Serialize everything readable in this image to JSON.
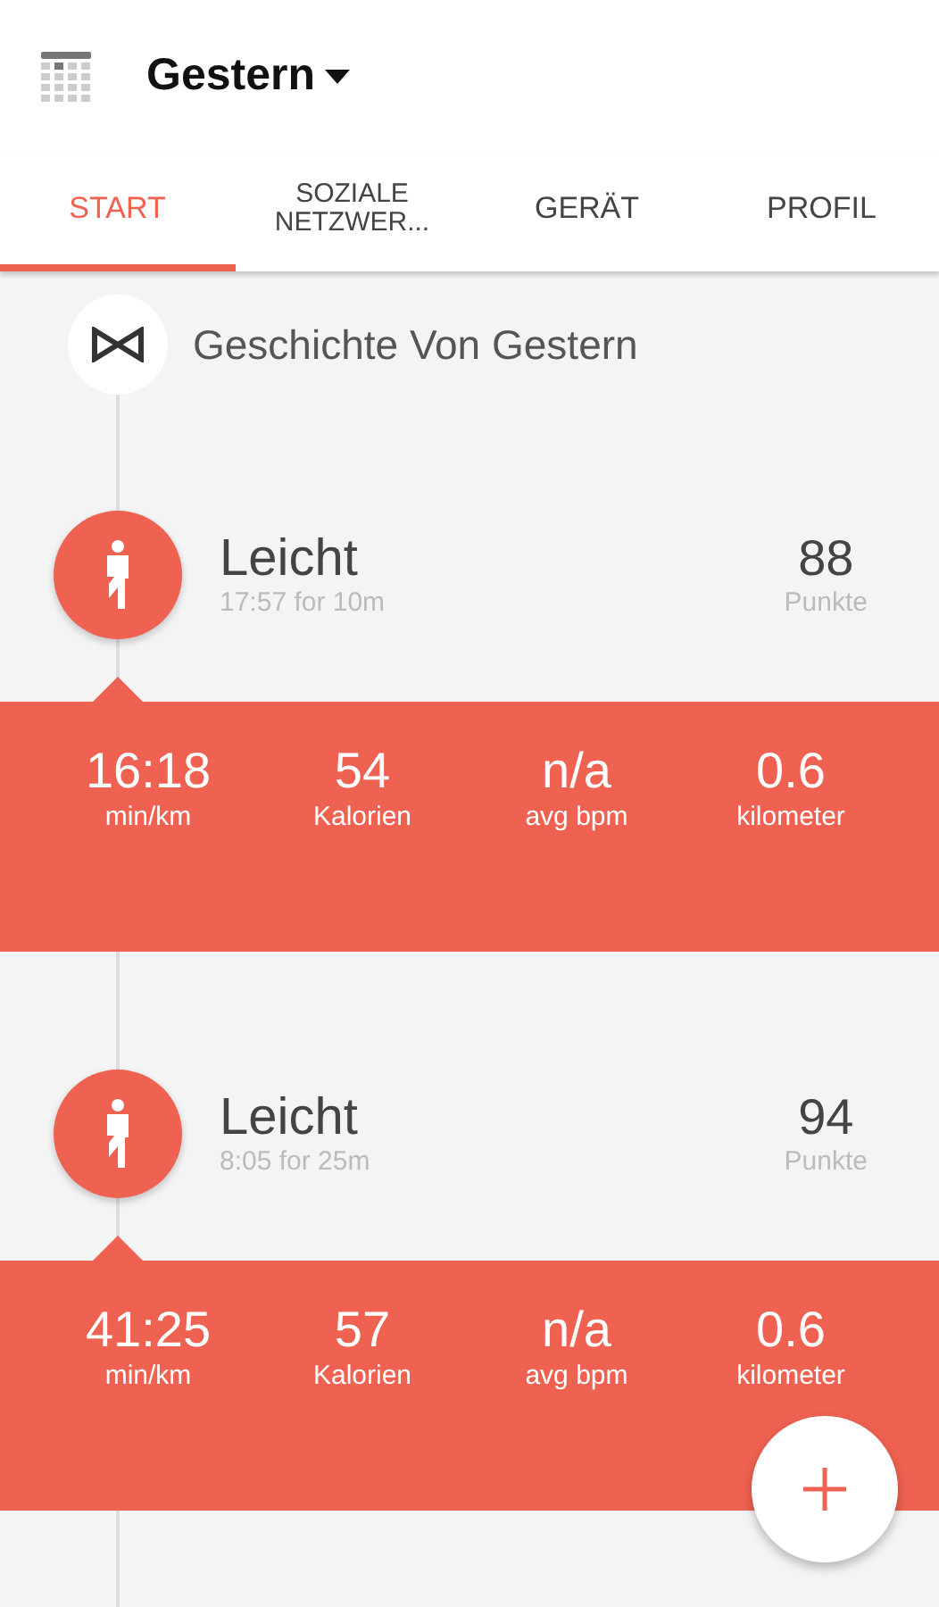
{
  "header": {
    "title": "Gestern"
  },
  "tabs": [
    {
      "label": "START",
      "selected": true
    },
    {
      "label": "SOZIALE NETZWER...",
      "selected": false
    },
    {
      "label": "GERÄT",
      "selected": false
    },
    {
      "label": "PROFIL",
      "selected": false
    }
  ],
  "story": {
    "title": "Geschichte Von Gestern"
  },
  "activities": [
    {
      "title": "Leicht",
      "subtitle": "17:57 for 10m",
      "score": "88",
      "score_label": "Punkte",
      "stats": [
        {
          "value": "16:18",
          "label": "min/km"
        },
        {
          "value": "54",
          "label": "Kalorien"
        },
        {
          "value": "n/a",
          "label": "avg bpm"
        },
        {
          "value": "0.6",
          "label": "kilometer"
        }
      ]
    },
    {
      "title": "Leicht",
      "subtitle": "8:05 for 25m",
      "score": "94",
      "score_label": "Punkte",
      "stats": [
        {
          "value": "41:25",
          "label": "min/km"
        },
        {
          "value": "57",
          "label": "Kalorien"
        },
        {
          "value": "n/a",
          "label": "avg bpm"
        },
        {
          "value": "0.6",
          "label": "kilometer"
        }
      ]
    }
  ]
}
